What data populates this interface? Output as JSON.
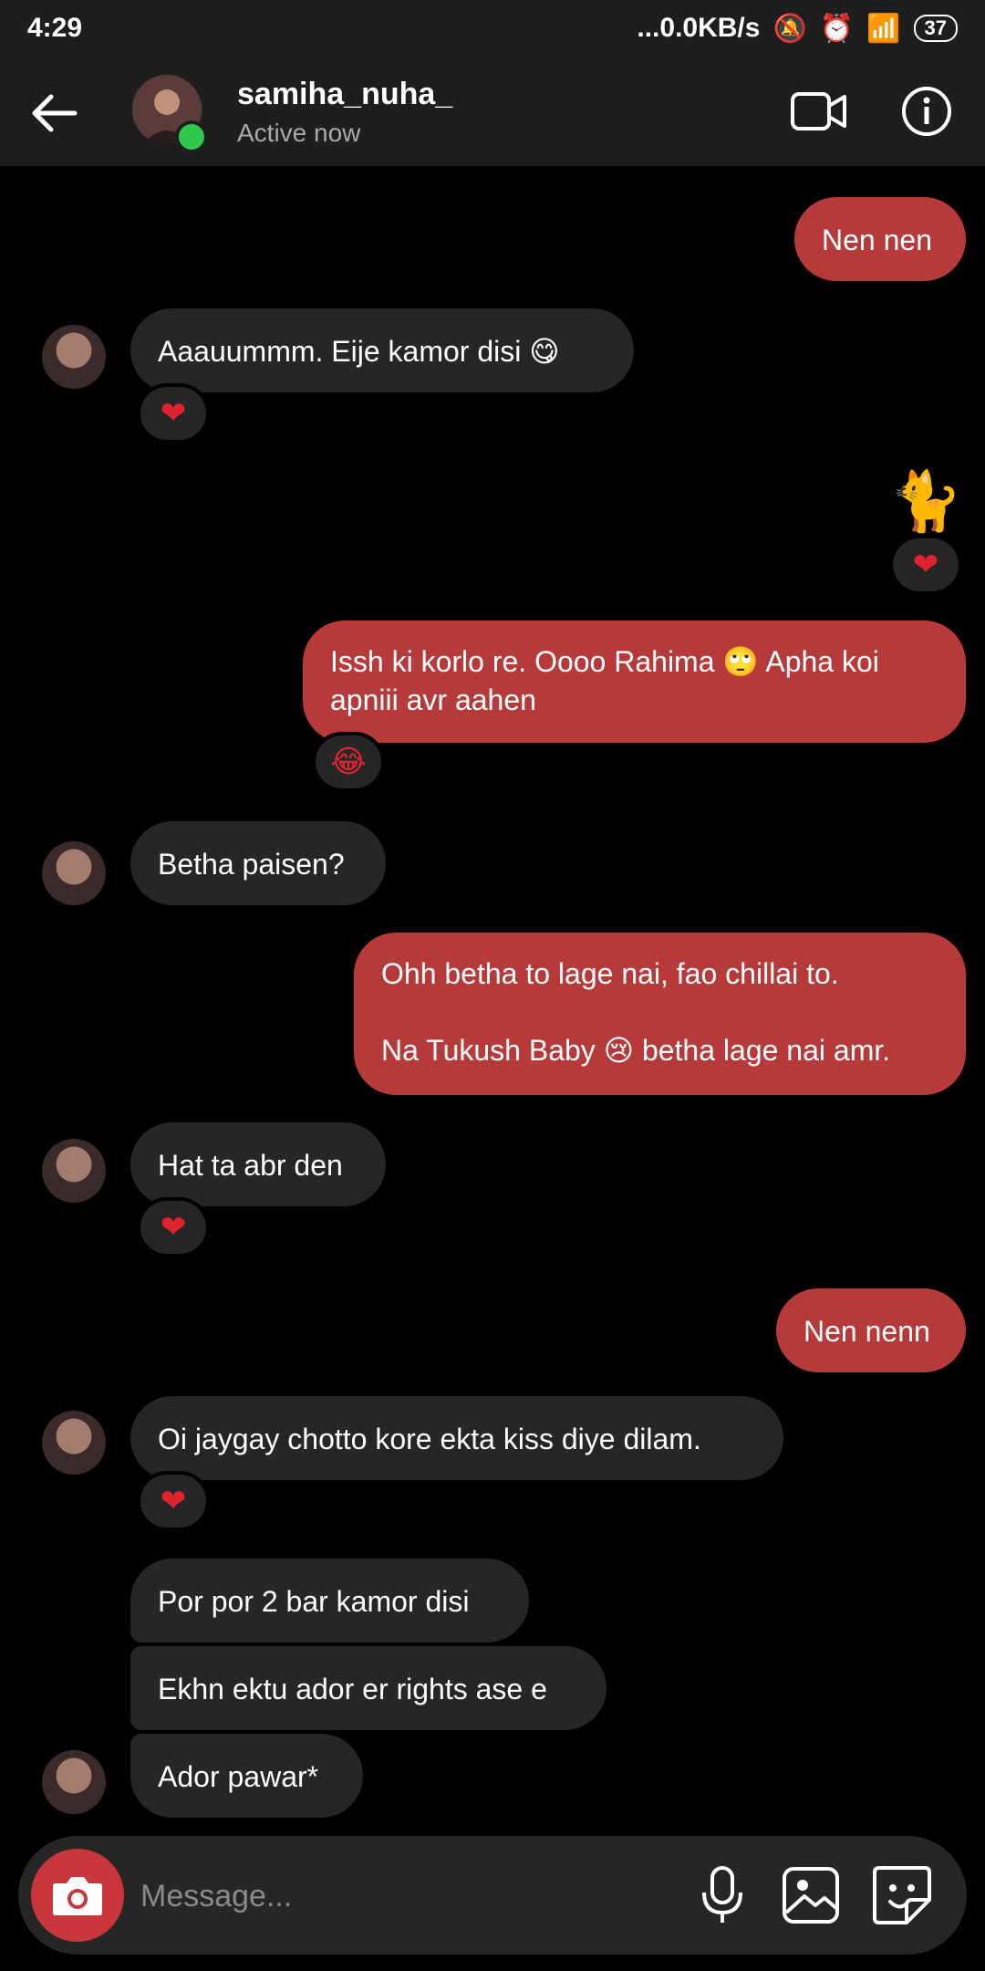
{
  "status_bar": {
    "time": "4:29",
    "net": "...0.0KB/s",
    "battery": "37"
  },
  "header": {
    "username": "samiha_nuha_",
    "status": "Active now"
  },
  "messages": [
    {
      "dir": "out",
      "text": "Nen nen"
    },
    {
      "dir": "in",
      "text": "Aaauummm. Eije kamor disi 😋",
      "reaction": "❤"
    },
    {
      "dir": "out",
      "text": "🐈",
      "reaction": "❤"
    },
    {
      "dir": "out",
      "text": "Issh ki korlo re. Oooo Rahima 🙄 Apha koi apniii avr aahen",
      "reaction": "😂"
    },
    {
      "dir": "in",
      "text": "Betha paisen?"
    },
    {
      "dir": "out",
      "text": "Ohh betha to lage nai, fao chillai to.\n\nNa Tukush Baby 😢 betha lage nai amr."
    },
    {
      "dir": "in",
      "text": "Hat ta abr den",
      "reaction": "❤"
    },
    {
      "dir": "out",
      "text": "Nen nenn"
    },
    {
      "dir": "in",
      "text": "Oi jaygay chotto kore ekta kiss diye dilam.",
      "reaction": "❤"
    },
    {
      "dir": "in",
      "text": "Por por 2 bar kamor disi"
    },
    {
      "dir": "in",
      "text": "Ekhn ektu ador er rights ase e"
    },
    {
      "dir": "in",
      "text": "Ador pawar*"
    }
  ],
  "composer": {
    "placeholder": "Message..."
  },
  "colors": {
    "outgoing_bubble": "#b73a3a",
    "incoming_bubble": "#262626",
    "camera_button": "#c9363c",
    "online_dot": "#2fc84b"
  }
}
